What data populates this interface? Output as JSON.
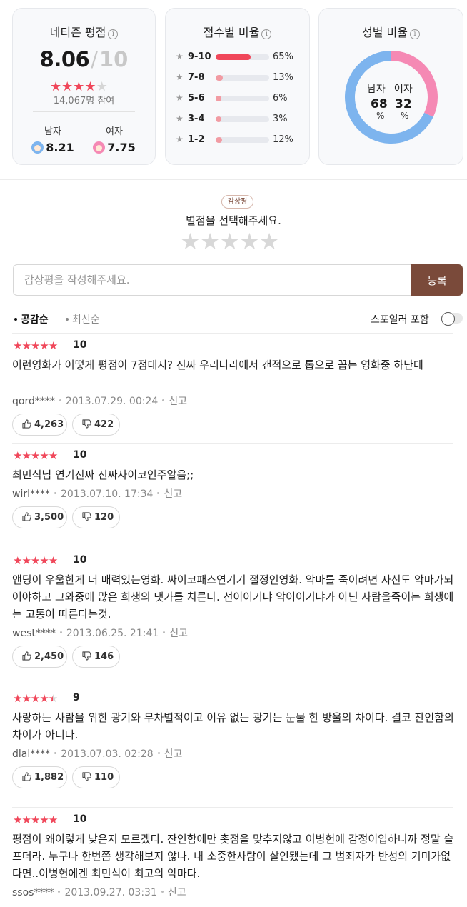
{
  "netizen": {
    "title": "네티즌 평점",
    "info_icon": "i",
    "score": "8.06",
    "slash": "/",
    "max": "10",
    "stars": 4,
    "participants": "14,067명 참여",
    "male_label": "남자",
    "male_score": "8.21",
    "female_label": "여자",
    "female_score": "7.75"
  },
  "distribution": {
    "title": "점수별 비율",
    "info_icon": "i",
    "star_icon": "★",
    "rows": [
      {
        "range": "9-10",
        "pct_label": "65%",
        "value": 65,
        "color": "#f0475a"
      },
      {
        "range": "7-8",
        "pct_label": "13%",
        "value": 13,
        "color": "#f29ba3"
      },
      {
        "range": "5-6",
        "pct_label": "6%",
        "value": 6,
        "color": "#f29ba3"
      },
      {
        "range": "3-4",
        "pct_label": "3%",
        "value": 3,
        "color": "#f29ba3"
      },
      {
        "range": "1-2",
        "pct_label": "12%",
        "value": 12,
        "color": "#f29ba3"
      }
    ]
  },
  "gender": {
    "title": "성별 비율",
    "info_icon": "i",
    "male_label": "남자",
    "female_label": "여자",
    "male_pct": "68",
    "female_pct": "32",
    "pct_sign": "%",
    "male_value": 68,
    "female_value": 32,
    "male_color": "#7db4ee",
    "female_color": "#f589b4"
  },
  "write": {
    "tag": "감상평",
    "prompt": "별점을 선택해주세요.",
    "stars": "★★★★★",
    "placeholder": "감상평을 작성해주세요.",
    "submit": "등록"
  },
  "sort": {
    "option_sympathy": "공감순",
    "option_latest": "최신순",
    "spoiler": "스포일러 포함"
  },
  "report_label": "신고",
  "reviews": [
    {
      "stars": 5,
      "score": "10",
      "text": "이런영화가 어떻게 평점이 7점대지? 진짜 우리나라에서 갠적으로 톱으로 꼽는 영화중 하난데",
      "user": "qord****",
      "date": "2013.07.29. 00:24",
      "likes": "4,263",
      "dislikes": "422"
    },
    {
      "stars": 5,
      "score": "10",
      "text": "최민식님 연기진짜 진짜사이코인주알음;;",
      "user": "wirl****",
      "date": "2013.07.10. 17:34",
      "likes": "3,500",
      "dislikes": "120"
    },
    {
      "stars": 5,
      "score": "10",
      "text": "앤딩이 우울한게 더 매력있는영화. 싸이코패스연기기 절정인영화. 악마를 죽이려면 자신도 악마가되어야하고 그와중에 많은 희생의 댓가를 치른다. 선이이기냐 악이이기냐가 아닌 사람을죽이는 희생에는 고통이 따른다는것.",
      "user": "west****",
      "date": "2013.06.25. 21:41",
      "likes": "2,450",
      "dislikes": "146"
    },
    {
      "stars": 4.5,
      "score": "9",
      "text": "사랑하는 사람을 위한 광기와 무차별적이고 이유 없는 광기는 눈물 한 방울의 차이다. 결코 잔인함의 차이가 아니다.",
      "user": "dlal****",
      "date": "2013.07.03. 02:28",
      "likes": "1,882",
      "dislikes": "110"
    },
    {
      "stars": 5,
      "score": "10",
      "text": "평점이 왜이렇게 낮은지 모르겠다. 잔인함에만 촛점을 맞추지않고 이병헌에 감정이입하니까 정말 슬프더라. 누구나 한번쯤 생각해보지 않나. 내 소중한사람이 살인됐는데 그 범죄자가 반성의 기미가없다면..이병헌에겐 최민식이 최고의 악마다.",
      "user": "ssos****",
      "date": "2013.09.27. 03:31",
      "likes": "",
      "dislikes": ""
    }
  ],
  "colors": {
    "accent_red": "#f0475a",
    "brown": "#7a4a3a",
    "star_off": "#d6d6d6"
  }
}
